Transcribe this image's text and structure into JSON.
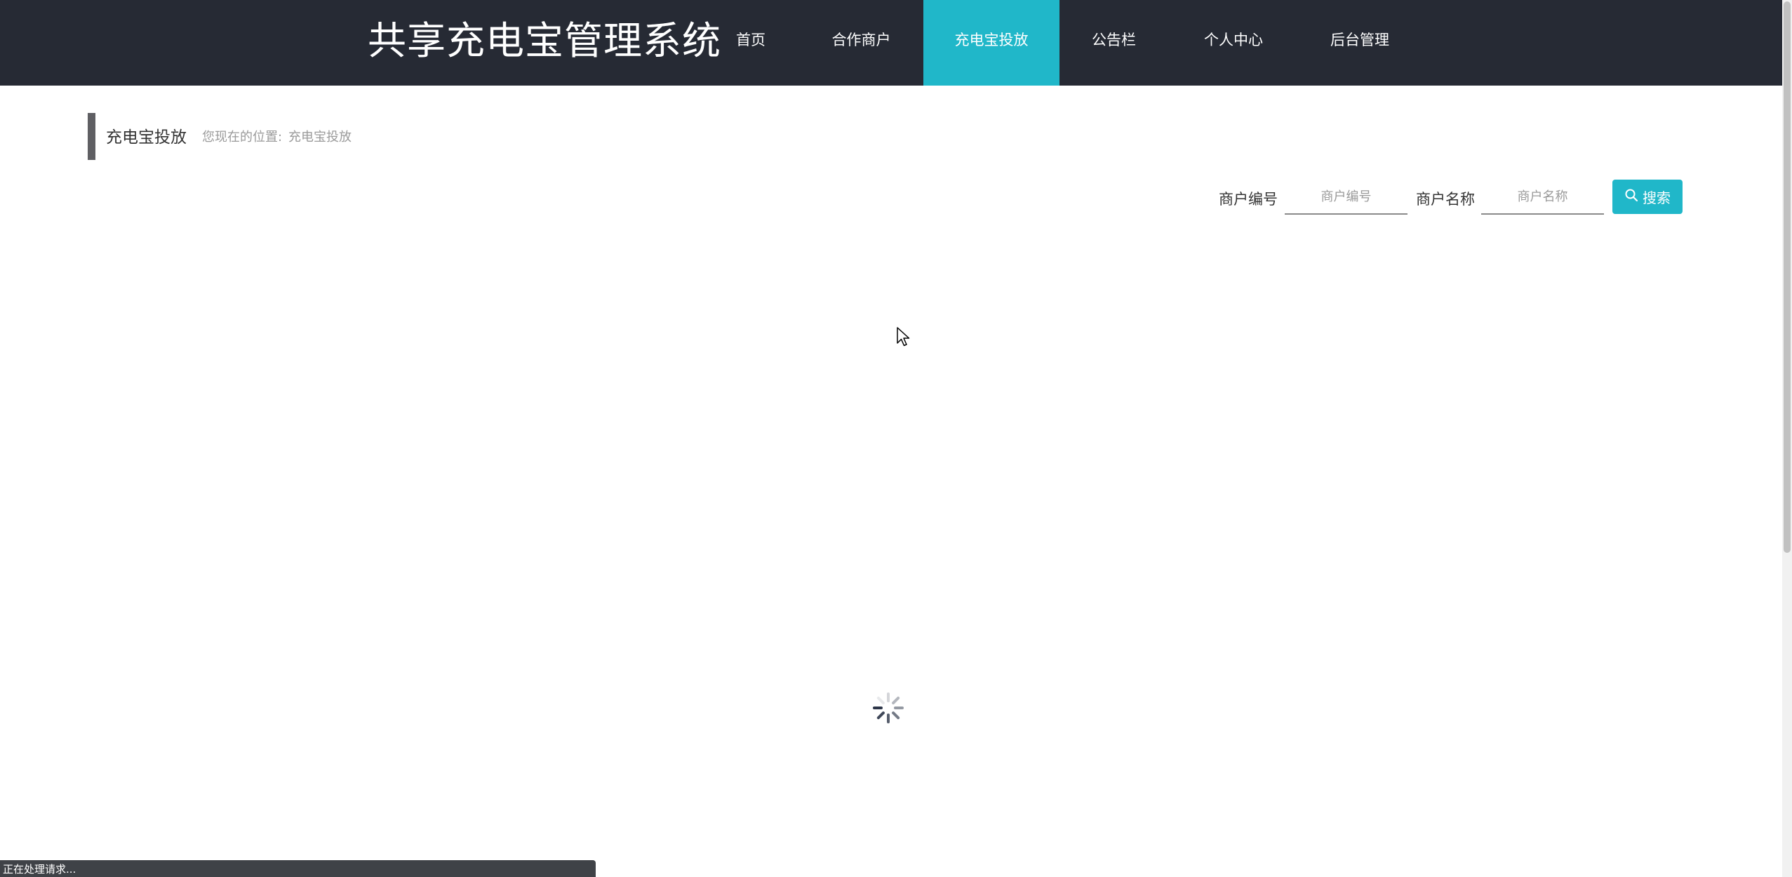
{
  "header": {
    "site_title": "共享充电宝管理系统",
    "nav": [
      {
        "label": "首页",
        "active": false
      },
      {
        "label": "合作商户",
        "active": false
      },
      {
        "label": "充电宝投放",
        "active": true
      },
      {
        "label": "公告栏",
        "active": false
      },
      {
        "label": "个人中心",
        "active": false
      },
      {
        "label": "后台管理",
        "active": false
      }
    ]
  },
  "breadcrumb": {
    "section_title": "充电宝投放",
    "prefix": "您现在的位置:",
    "current": "充电宝投放"
  },
  "search": {
    "merchant_id_label": "商户编号",
    "merchant_id_placeholder": "商户编号",
    "merchant_id_value": "",
    "merchant_name_label": "商户名称",
    "merchant_name_placeholder": "商户名称",
    "merchant_name_value": "",
    "button_label": "搜索",
    "button_icon": "search-icon"
  },
  "loading": {
    "icon": "loading-spinner-icon"
  },
  "status_bar": {
    "text": "正在处理请求..."
  },
  "colors": {
    "header_bg": "#262a34",
    "accent": "#20b7c9",
    "breadcrumb_bar": "#5f5f63",
    "status_bg": "#3f4247"
  }
}
